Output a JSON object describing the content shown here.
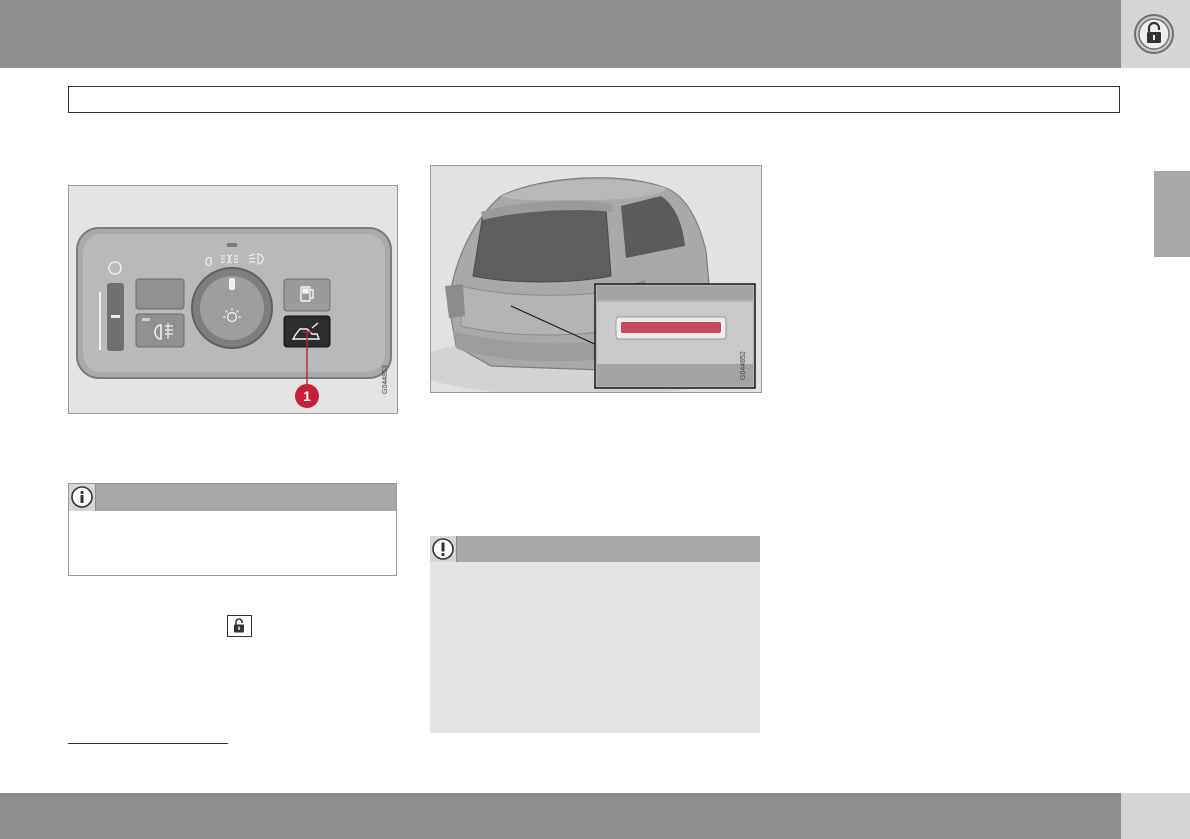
{
  "figures": {
    "headlight_panel": {
      "callout": "1",
      "dial_off": "0",
      "figure_code": "G044853"
    },
    "car_rear": {
      "figure_code": "G044852"
    }
  },
  "icons": {
    "header_badge": "padlock-open-icon",
    "info_note": "info-icon",
    "warning_note": "exclamation-icon",
    "inline_symbol": "padlock-open-icon"
  },
  "colors": {
    "band_gray": "#8d8e90",
    "light_tab": "#d5d6d8",
    "callout_red": "#c8203a",
    "handle_red": "#c94a5e"
  }
}
